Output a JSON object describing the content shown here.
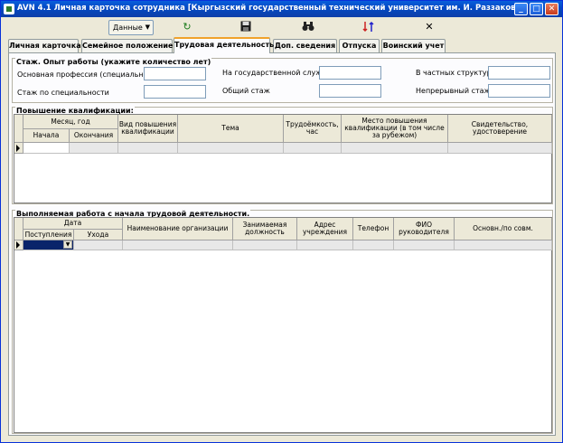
{
  "window": {
    "title": "AVN 4.1 Личная карточка сотрудника [Кыргызский государственный технический университет им. И. Раззакова]",
    "min": "_",
    "max": "□",
    "close": "✕"
  },
  "toolbar": {
    "data_label": "Данные",
    "icons": [
      "refresh-icon",
      "save-icon",
      "binoculars-icon",
      "sort-icon",
      "close-icon"
    ]
  },
  "tabs": [
    {
      "label": "Личная карточка",
      "active": false
    },
    {
      "label": "Семейное положение",
      "active": false
    },
    {
      "label": "Трудовая деятельность",
      "active": true
    },
    {
      "label": "Доп. сведения",
      "active": false
    },
    {
      "label": "Отпуска",
      "active": false
    },
    {
      "label": "Воинский учет",
      "active": false
    }
  ],
  "experience": {
    "title": "Стаж. Опыт работы (укажите количество лет)",
    "main_profession": "Основная профессия (специальность)",
    "specialty": "Стаж по специальности",
    "state_service": "На государственной службе",
    "total": "Общий стаж",
    "private": "В частных структурах",
    "continuous": "Непрерывный стаж"
  },
  "qualification": {
    "title": "Повышение квалификации:",
    "headers": {
      "month_year": "Месяц, год",
      "start": "Начала",
      "end": "Окончания",
      "type": "Вид повышения квалификации",
      "topic": "Тема",
      "hours": "Трудоёмкость, час",
      "place": "Место повышения квалификации (в том числе за рубежом)",
      "certificate": "Свидетельство, удостоверение"
    }
  },
  "work": {
    "title": "Выполняемая работа с начала трудовой деятельности.",
    "headers": {
      "date": "Дата",
      "hire": "Поступления",
      "leave": "Ухода",
      "org": "Наименование организации",
      "position": "Занимаемая должность",
      "address": "Адрес учреждения",
      "phone": "Телефон",
      "head": "ФИО руководителя",
      "main": "Основн./по совм."
    }
  }
}
